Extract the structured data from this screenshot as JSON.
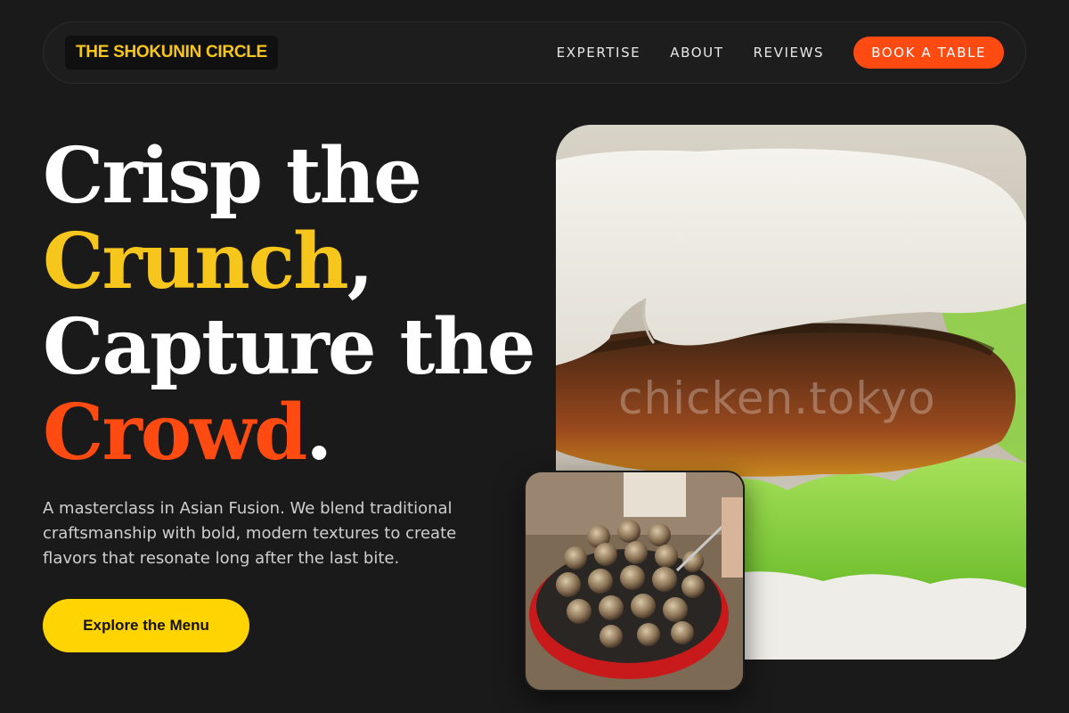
{
  "nav": {
    "brand": "THE SHOKUNIN CIRCLE",
    "links": [
      "EXPERTISE",
      "ABOUT",
      "REVIEWS"
    ],
    "book_label": "BOOK A TABLE"
  },
  "hero": {
    "line1": "Crisp the",
    "word_yellow": "Crunch",
    "comma": ",",
    "line3": "Capture the",
    "word_orange": "Crowd",
    "period": ".",
    "description": "A masterclass in Asian Fusion. We blend traditional craftsmanship with bold, modern textures to create flavors that resonate long after the last bite.",
    "cta_label": "Explore the Menu"
  },
  "images": {
    "main_watermark": "chicken.tokyo"
  },
  "colors": {
    "background": "#1a1a1b",
    "yellow": "#f7c61c",
    "orange": "#ff4a12",
    "cta": "#ffd400"
  }
}
